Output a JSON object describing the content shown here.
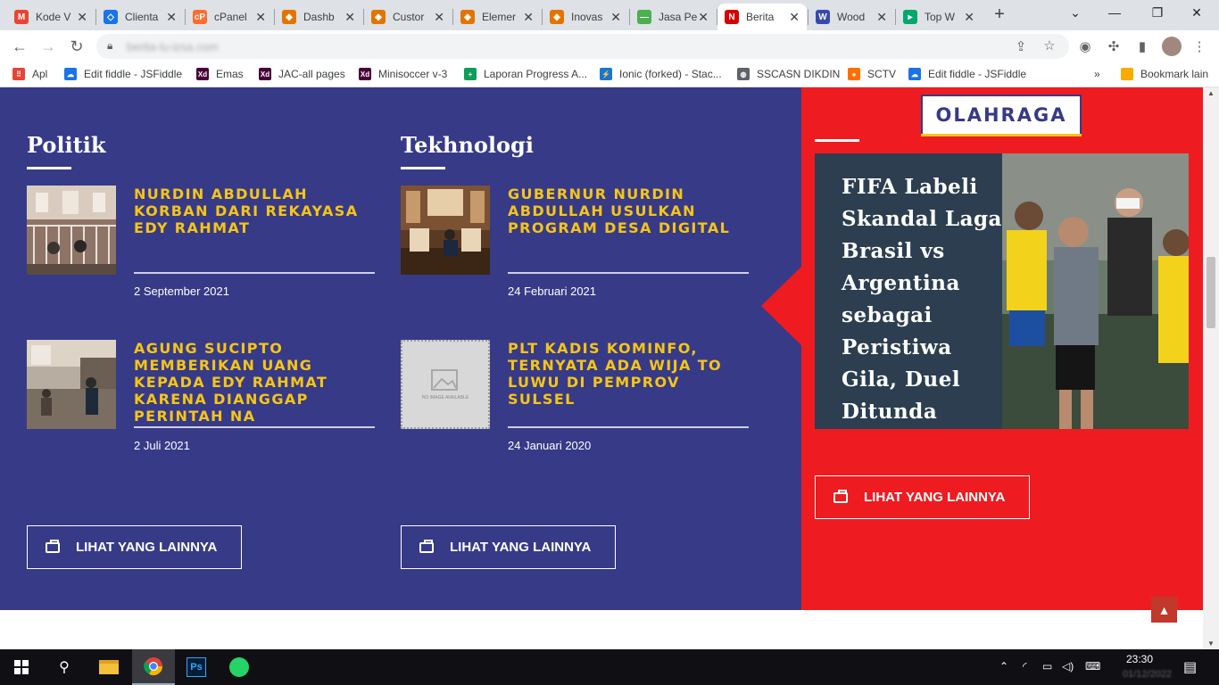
{
  "browser": {
    "tabs": [
      {
        "title": "Kode V",
        "icon": "gmail-icon",
        "color": "#ea4335",
        "glyph": "M"
      },
      {
        "title": "Clienta",
        "icon": "cloud-icon",
        "color": "#1a73e8",
        "glyph": "◇"
      },
      {
        "title": "cPanel",
        "icon": "cpanel-icon",
        "color": "#ff6c2c",
        "glyph": "cP"
      },
      {
        "title": "Dashb",
        "icon": "site-icon",
        "color": "#e37400",
        "glyph": "◈"
      },
      {
        "title": "Custor",
        "icon": "site-icon",
        "color": "#e37400",
        "glyph": "◈"
      },
      {
        "title": "Elemer",
        "icon": "site-icon",
        "color": "#e37400",
        "glyph": "◈"
      },
      {
        "title": "Inovas",
        "icon": "site-icon",
        "color": "#e37400",
        "glyph": "◈"
      },
      {
        "title": "Jasa Pe",
        "icon": "site-icon",
        "color": "#4caf50",
        "glyph": "—"
      },
      {
        "title": "Berita",
        "icon": "news-icon",
        "color": "#d50000",
        "glyph": "N"
      },
      {
        "title": "Wood",
        "icon": "site-icon",
        "color": "#3949ab",
        "glyph": "W"
      },
      {
        "title": "Top W",
        "icon": "play-icon",
        "color": "#00a86b",
        "glyph": "▸"
      }
    ],
    "active_tab": 8,
    "url": "berita-lu-izsa.com",
    "bookmarks": [
      {
        "label": "Apl",
        "icon": "apps-icon",
        "color": "#ea4335",
        "glyph": "⠿"
      },
      {
        "label": "Edit fiddle - JSFiddle",
        "icon": "cloud-icon",
        "color": "#1a73e8",
        "glyph": "☁"
      },
      {
        "label": "Emas",
        "icon": "xd-icon",
        "color": "#470137",
        "glyph": "Xd"
      },
      {
        "label": "JAC-all pages",
        "icon": "xd-icon",
        "color": "#470137",
        "glyph": "Xd"
      },
      {
        "label": "Minisoccer v-3",
        "icon": "xd-icon",
        "color": "#470137",
        "glyph": "Xd"
      },
      {
        "label": "Laporan Progress A...",
        "icon": "sheets-icon",
        "color": "#0f9d58",
        "glyph": "+"
      },
      {
        "label": "Ionic (forked) - Stac...",
        "icon": "bolt-icon",
        "color": "#1976d2",
        "glyph": "⚡"
      },
      {
        "label": "SSCASN DIKDIN",
        "icon": "globe-icon",
        "color": "#5f6368",
        "glyph": "◍"
      },
      {
        "label": "SCTV",
        "icon": "sctv-icon",
        "color": "#ff6f00",
        "glyph": "●"
      },
      {
        "label": "Edit fiddle - JSFiddle",
        "icon": "cloud-icon",
        "color": "#1a73e8",
        "glyph": "☁"
      }
    ],
    "bookmarks_overflow": "»",
    "other_bookmarks": "Bookmark lain"
  },
  "page": {
    "politik": {
      "title": "Politik",
      "items": [
        {
          "headline": "NURDIN ABDULLAH KORBAN DARI REKAYASA EDY RAHMAT",
          "date": "2 September 2021"
        },
        {
          "headline": "AGUNG SUCIPTO MEMBERIKAN UANG KEPADA EDY RAHMAT KARENA DIANGGAP PERINTAH NA",
          "date": "2 Juli 2021"
        }
      ],
      "more": "LIHAT YANG LAINNYA"
    },
    "tekhnologi": {
      "title": "Tekhnologi",
      "items": [
        {
          "headline": "GUBERNUR NURDIN ABDULLAH USULKAN PROGRAM DESA DIGITAL",
          "date": "24 Februari 2021"
        },
        {
          "headline": "PLT KADIS KOMINFO, TERNYATA ADA WIJA TO LUWU DI PEMPROV SULSEL",
          "date": "24 Januari 2020",
          "no_image_text": "NO IMAGE AVAILABLE"
        }
      ],
      "more": "LIHAT YANG LAINNYA"
    },
    "olahraga": {
      "badge": "OLAHRAGA",
      "feature_title": "FIFA Labeli Skandal Laga Brasil vs Argentina sebagai Peristiwa Gila, Duel Ditunda",
      "more": "LIHAT YANG LAINNYA"
    },
    "back_to_top": "▲"
  },
  "taskbar": {
    "time": "23:30",
    "date": "01/12/2022"
  }
}
